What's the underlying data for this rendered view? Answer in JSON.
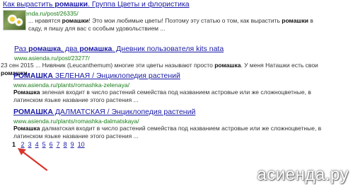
{
  "results": [
    {
      "title_parts": [
        [
          "Как вырастить ",
          false
        ],
        [
          "ромашки",
          true
        ],
        [
          ". Группа Цветы и флористика",
          false
        ]
      ],
      "url": "www.asienda.ru/post/26335/",
      "snippet_parts": [
        [
          "... нравятся ",
          false
        ],
        [
          "ромашки",
          true
        ],
        [
          "! Это мои любимые цветы! Поэтому эту статью о том, как вырастить ",
          false
        ],
        [
          "ромашки",
          true
        ],
        [
          " в саду, я пишу для вас с особым удовольствием ...",
          false
        ]
      ]
    },
    {
      "title_parts": [
        [
          "Раз ",
          false
        ],
        [
          "ромашка",
          true
        ],
        [
          ", два ",
          false
        ],
        [
          "ромашка",
          true
        ],
        [
          ". Дневник пользователя kits nata",
          false
        ]
      ],
      "url": "www.asienda.ru/post/23277/",
      "snippet_parts": [
        [
          "23 сен 2015 ... Нивяник (Leucanthemum) многие эти цветы называют просто ",
          false
        ],
        [
          "ромашка",
          true
        ],
        [
          ". У меня Наташки есть свои ",
          false
        ],
        [
          "ромашки",
          true
        ],
        [
          ".",
          false
        ]
      ]
    },
    {
      "title_parts": [
        [
          "РОМАШКА",
          true
        ],
        [
          " ЗЕЛЕНАЯ / Энциклопедия растений",
          false
        ]
      ],
      "url": "www.asienda.ru/plants/romashka-zelenaya/",
      "snippet_parts": [
        [
          "Ромашка",
          true
        ],
        [
          " зеленая входит в число растений семейства под названием астровые или же сложноцветные, в латинском языке название этого растения ...",
          false
        ]
      ]
    },
    {
      "title_parts": [
        [
          "РОМАШКА",
          true
        ],
        [
          " ДАЛМАТСКАЯ / Энциклопедия растений",
          false
        ]
      ],
      "url": "www.asienda.ru/plants/romashka-dalmatskaya/",
      "snippet_parts": [
        [
          "Ромашка",
          true
        ],
        [
          " далматская входит в число растений семейства под названием астровые или же сложноцветные, в латинском языке название этого растения ...",
          false
        ]
      ]
    }
  ],
  "pagination": {
    "current": "1",
    "pages": [
      "2",
      "3",
      "4",
      "5",
      "6",
      "7",
      "8",
      "9",
      "10"
    ]
  },
  "annotation": {
    "arrow_color": "#d9342b"
  },
  "watermark": "асиенда.ру"
}
